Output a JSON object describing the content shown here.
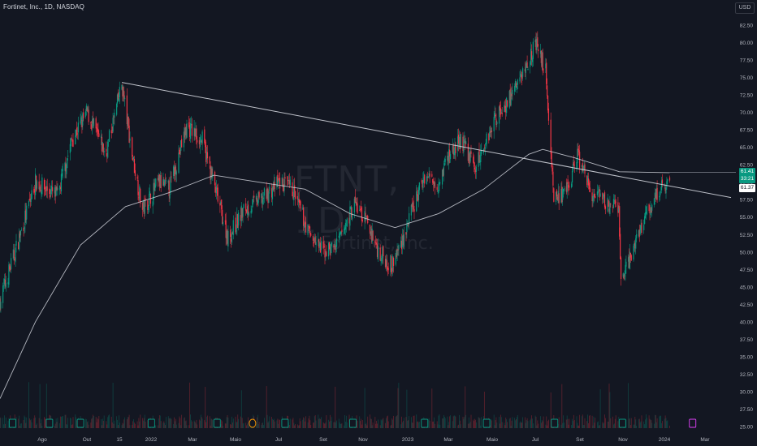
{
  "header": {
    "title": "Fortinet, Inc., 1D, NASDAQ",
    "currency": "USD"
  },
  "watermark": {
    "main": "FTNT, 1D",
    "sub": "Fortinet, Inc."
  },
  "price_badges": {
    "last_price": "61.41",
    "countdown": "33:21",
    "ma_value": "61.37"
  },
  "colors": {
    "background": "#131722",
    "up": "#089981",
    "down": "#f23645",
    "trendline": "#d1d4dc",
    "ma_line": "#d1d4dc",
    "earnings_marker": "#089981",
    "dividend_marker": "#ff9800",
    "upcoming_earnings_marker": "#e040fb"
  },
  "chart_data": {
    "type": "candlestick",
    "title": "Fortinet, Inc., 1D, NASDAQ",
    "y_ticks": [
      "82.50",
      "80.00",
      "77.50",
      "75.00",
      "72.50",
      "70.00",
      "67.50",
      "65.00",
      "62.50",
      "60.00",
      "57.50",
      "55.00",
      "52.50",
      "50.00",
      "47.50",
      "45.00",
      "42.50",
      "40.00",
      "37.50",
      "35.00",
      "32.50",
      "30.00",
      "27.50",
      "25.00"
    ],
    "ylim": [
      25,
      83
    ],
    "x_ticks": [
      "Ago",
      "Out",
      "15",
      "2022",
      "Mar",
      "Maio",
      "Jul",
      "Set",
      "Nov",
      "2023",
      "Mar",
      "Maio",
      "Jul",
      "Set",
      "Nov",
      "2024",
      "Mar"
    ],
    "x_range": [
      "2021-07-15",
      "2024-03-31"
    ],
    "price_path": [
      [
        "2021-07-15",
        43
      ],
      [
        "2021-08-10",
        52
      ],
      [
        "2021-09-01",
        60
      ],
      [
        "2021-10-01",
        58
      ],
      [
        "2021-10-20",
        66
      ],
      [
        "2021-11-10",
        70
      ],
      [
        "2021-12-05",
        64
      ],
      [
        "2021-12-27",
        74
      ],
      [
        "2022-01-10",
        64
      ],
      [
        "2022-01-24",
        56
      ],
      [
        "2022-02-15",
        60
      ],
      [
        "2022-03-01",
        59
      ],
      [
        "2022-03-25",
        68
      ],
      [
        "2022-04-15",
        66
      ],
      [
        "2022-05-05",
        58
      ],
      [
        "2022-05-20",
        52
      ],
      [
        "2022-06-10",
        56
      ],
      [
        "2022-07-10",
        58
      ],
      [
        "2022-07-28",
        60
      ],
      [
        "2022-08-15",
        59
      ],
      [
        "2022-09-05",
        53
      ],
      [
        "2022-09-25",
        50
      ],
      [
        "2022-10-15",
        51
      ],
      [
        "2022-11-07",
        57
      ],
      [
        "2022-11-25",
        54
      ],
      [
        "2022-12-10",
        50
      ],
      [
        "2022-12-28",
        48
      ],
      [
        "2023-01-15",
        53
      ],
      [
        "2023-02-10",
        61
      ],
      [
        "2023-02-28",
        60
      ],
      [
        "2023-03-15",
        64
      ],
      [
        "2023-04-01",
        66
      ],
      [
        "2023-04-20",
        62
      ],
      [
        "2023-05-15",
        69
      ],
      [
        "2023-06-05",
        72
      ],
      [
        "2023-06-25",
        76
      ],
      [
        "2023-07-10",
        80
      ],
      [
        "2023-07-24",
        76
      ],
      [
        "2023-08-04",
        58
      ],
      [
        "2023-08-20",
        58
      ],
      [
        "2023-09-05",
        64
      ],
      [
        "2023-09-25",
        58
      ],
      [
        "2023-10-15",
        57
      ],
      [
        "2023-10-31",
        56
      ],
      [
        "2023-11-03",
        46
      ],
      [
        "2023-11-15",
        49
      ],
      [
        "2023-12-01",
        54
      ],
      [
        "2023-12-20",
        58
      ],
      [
        "2024-01-02",
        60
      ],
      [
        "2024-01-08",
        61.41
      ]
    ],
    "moving_average": [
      [
        "2021-07-15",
        29
      ],
      [
        "2021-09-01",
        40
      ],
      [
        "2021-11-01",
        51
      ],
      [
        "2022-01-01",
        56.5
      ],
      [
        "2022-03-01",
        58.5
      ],
      [
        "2022-05-01",
        61
      ],
      [
        "2022-07-01",
        60
      ],
      [
        "2022-09-01",
        59
      ],
      [
        "2022-11-01",
        55.5
      ],
      [
        "2023-01-01",
        53.5
      ],
      [
        "2023-03-01",
        55.5
      ],
      [
        "2023-05-01",
        59
      ],
      [
        "2023-07-01",
        64
      ],
      [
        "2023-07-20",
        64.7
      ],
      [
        "2023-09-01",
        63.5
      ],
      [
        "2023-11-01",
        61.5
      ],
      [
        "2024-01-08",
        61.37
      ]
    ],
    "trendline": [
      [
        "2021-12-27",
        74.3
      ],
      [
        "2024-03-31",
        57.8
      ]
    ],
    "last_price_line": 61.41,
    "event_markers": [
      {
        "date": "2021-08-01",
        "type": "earnings"
      },
      {
        "date": "2021-09-20",
        "type": "earnings"
      },
      {
        "date": "2021-11-01",
        "type": "earnings"
      },
      {
        "date": "2022-02-05",
        "type": "earnings"
      },
      {
        "date": "2022-05-05",
        "type": "earnings"
      },
      {
        "date": "2022-06-22",
        "type": "dividend"
      },
      {
        "date": "2022-08-05",
        "type": "earnings"
      },
      {
        "date": "2022-11-05",
        "type": "earnings"
      },
      {
        "date": "2023-02-10",
        "type": "earnings"
      },
      {
        "date": "2023-05-05",
        "type": "earnings"
      },
      {
        "date": "2023-08-05",
        "type": "earnings"
      },
      {
        "date": "2023-11-05",
        "type": "earnings"
      },
      {
        "date": "2024-02-08",
        "type": "upcoming"
      }
    ]
  }
}
